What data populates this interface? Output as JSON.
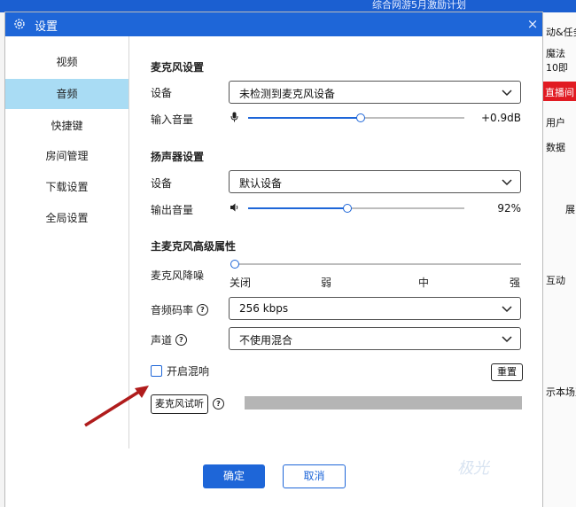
{
  "background": {
    "banner": "综合网游5月激励计划",
    "right_texts": [
      "动&任务",
      "魔法",
      "10即",
      "直播间",
      "用户",
      "数据",
      "展",
      "互动",
      "示本场直"
    ]
  },
  "dialog": {
    "title": "设置",
    "close": "×"
  },
  "sidebar": {
    "items": [
      {
        "label": "视频",
        "active": false
      },
      {
        "label": "音频",
        "active": true
      },
      {
        "label": "快捷键",
        "active": false
      },
      {
        "label": "房间管理",
        "active": false
      },
      {
        "label": "下载设置",
        "active": false
      },
      {
        "label": "全局设置",
        "active": false
      }
    ]
  },
  "mic": {
    "section": "麦克风设置",
    "device_label": "设备",
    "device_value": "未检测到麦克风设备",
    "volume_label": "输入音量",
    "volume_value": "+0.9dB",
    "volume_fraction": 0.52
  },
  "speaker": {
    "section": "扬声器设置",
    "device_label": "设备",
    "device_value": "默认设备",
    "volume_label": "输出音量",
    "volume_value": "92%",
    "volume_fraction": 0.46
  },
  "advanced": {
    "section": "主麦克风高级属性",
    "noise_label": "麦克风降噪",
    "noise_ticks": [
      "关闭",
      "弱",
      "中",
      "强"
    ],
    "noise_level": 0,
    "bitrate_label": "音频码率",
    "bitrate_value": "256 kbps",
    "channel_label": "声道",
    "channel_value": "不使用混合",
    "reverb_label": "开启混响",
    "reverb_checked": false,
    "reset_label": "重置",
    "mic_test_label": "麦克风试听"
  },
  "footer": {
    "ok_label": "确定",
    "cancel_label": "取消"
  },
  "colors": {
    "accent": "#1e66d8",
    "active_nav": "#a9dcf4",
    "track": "#bdbdbd"
  },
  "watermark": "极光"
}
